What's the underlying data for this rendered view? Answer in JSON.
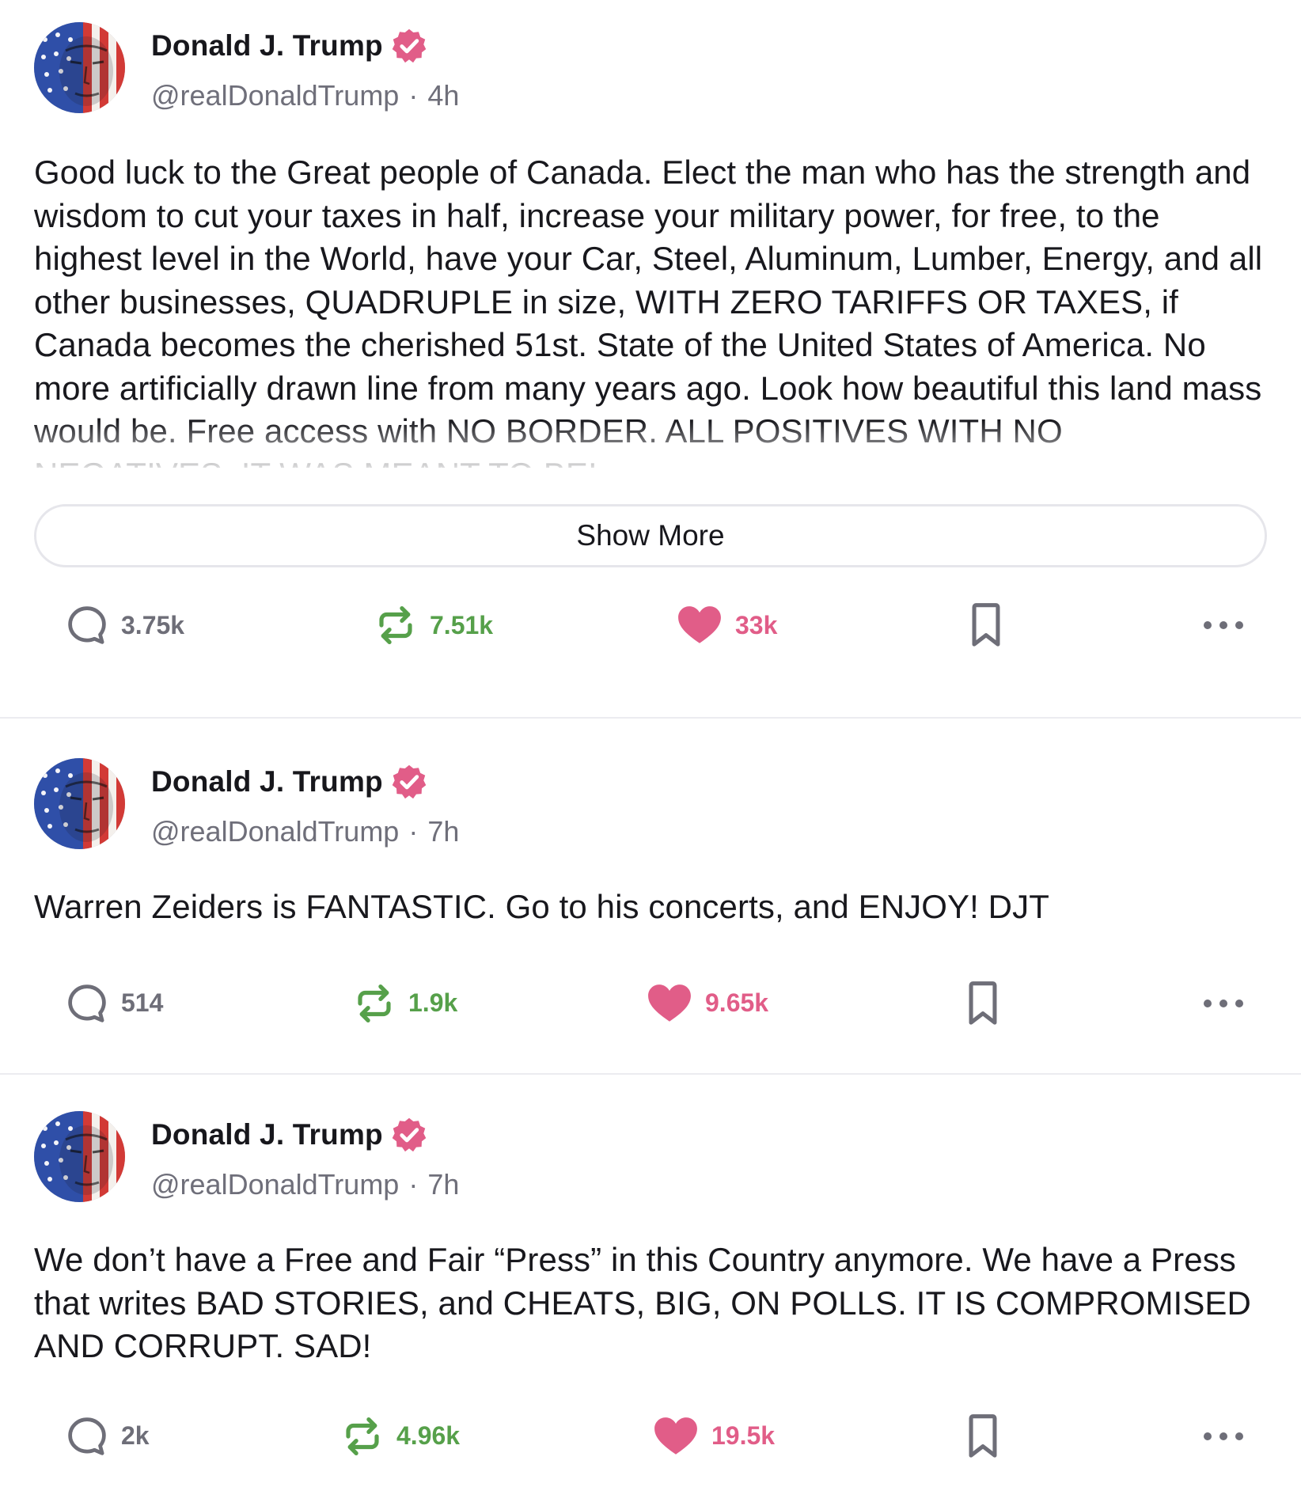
{
  "colors": {
    "accent": "#e15d88",
    "retruth": "#56a04a",
    "muted": "#6f6f7a",
    "verified_badge": "#e15d88"
  },
  "ui": {
    "show_more_label": "Show More"
  },
  "posts": [
    {
      "author": {
        "name": "Donald J. Trump",
        "handle": "@realDonaldTrump",
        "verified": true,
        "avatar": "flag-portrait-avatar"
      },
      "time": "4h",
      "body": "Good luck to the Great people of Canada. Elect the man who has the strength and wisdom to cut your taxes in half, increase your military power, for free, to the highest level in the World, have your Car, Steel, Aluminum, Lumber, Energy, and all other businesses, QUADRUPLE in size, WITH ZERO TARIFFS OR TAXES, if Canada becomes the cherished 51st. State of the United States of America. No more artificially drawn line from many years ago. Look how beautiful this land mass would be. Free access with NO BORDER. ALL POSITIVES WITH NO NEGATIVES. IT WAS MEANT TO BE!",
      "truncated": true,
      "stats": {
        "replies": "3.75k",
        "retruths": "7.51k",
        "likes": "33k"
      }
    },
    {
      "author": {
        "name": "Donald J. Trump",
        "handle": "@realDonaldTrump",
        "verified": true,
        "avatar": "flag-portrait-avatar"
      },
      "time": "7h",
      "body": "Warren Zeiders is FANTASTIC. Go to his concerts, and ENJOY! DJT",
      "truncated": false,
      "stats": {
        "replies": "514",
        "retruths": "1.9k",
        "likes": "9.65k"
      }
    },
    {
      "author": {
        "name": "Donald J. Trump",
        "handle": "@realDonaldTrump",
        "verified": true,
        "avatar": "flag-portrait-avatar"
      },
      "time": "7h",
      "body": "We don’t have a Free and Fair “Press” in this Country anymore. We have a Press that writes BAD STORIES, and CHEATS, BIG, ON POLLS. IT IS COMPROMISED AND CORRUPT. SAD!",
      "truncated": false,
      "stats": {
        "replies": "2k",
        "retruths": "4.96k",
        "likes": "19.5k"
      }
    }
  ]
}
